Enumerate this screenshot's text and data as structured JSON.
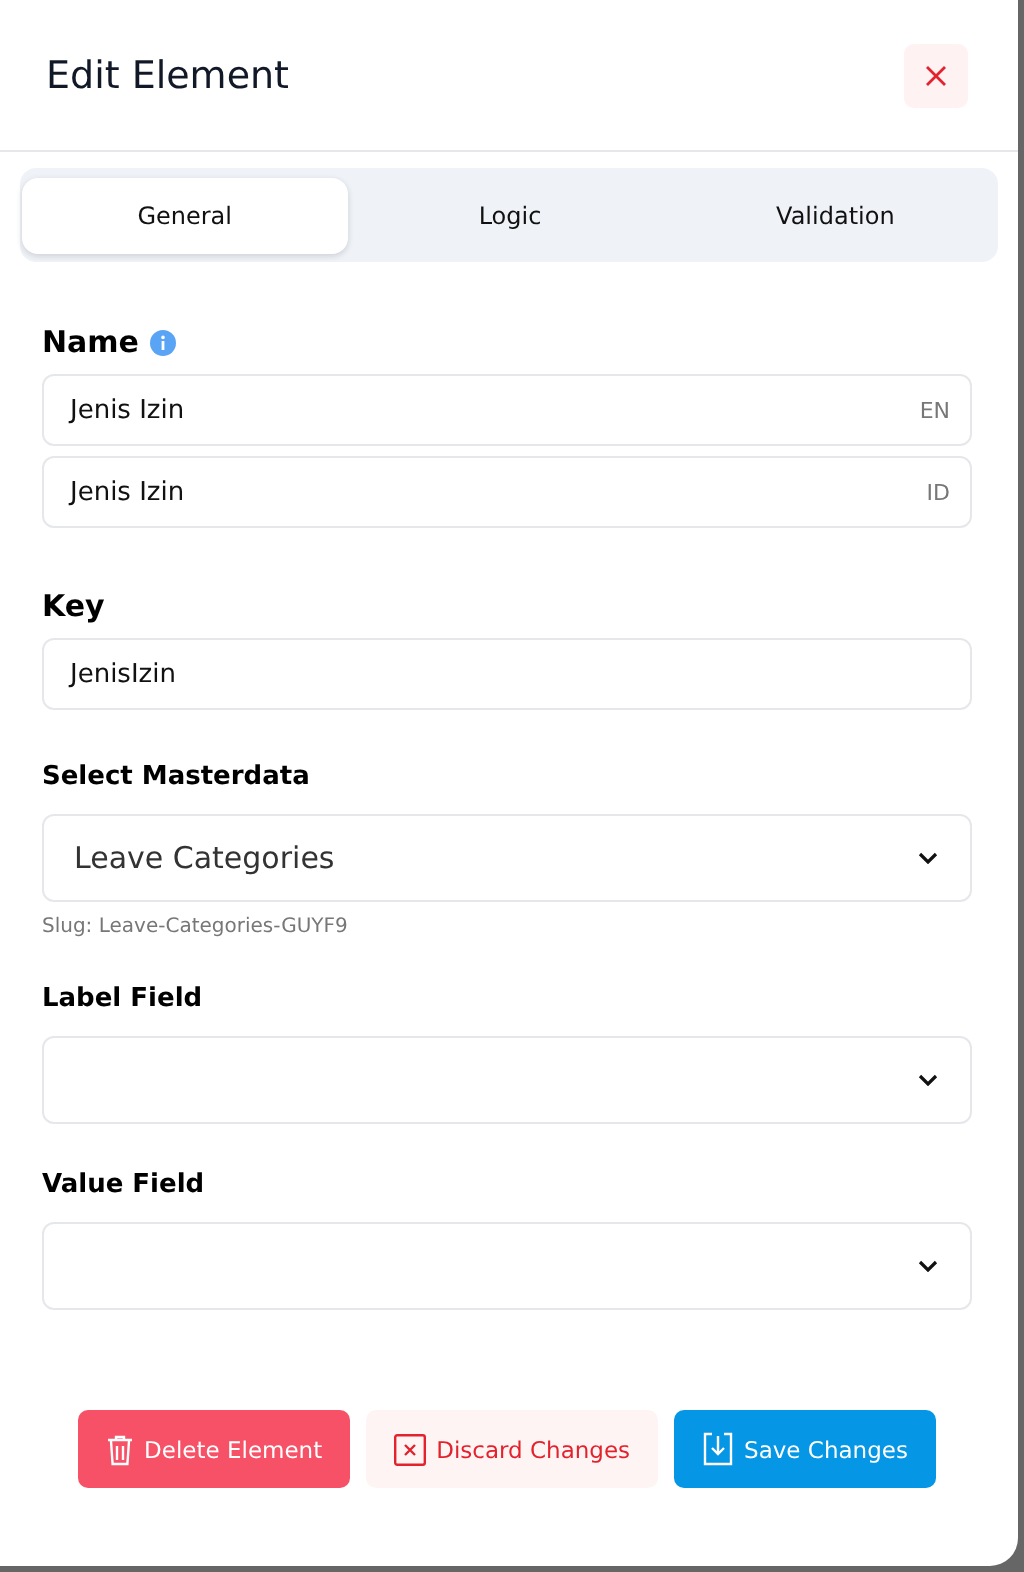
{
  "dialog": {
    "title": "Edit Element"
  },
  "tabs": [
    {
      "label": "General",
      "selected": true
    },
    {
      "label": "Logic",
      "selected": false
    },
    {
      "label": "Validation",
      "selected": false
    }
  ],
  "name": {
    "label": "Name",
    "translations": [
      {
        "value": "Jenis Izin",
        "lang": "EN"
      },
      {
        "value": "Jenis Izin",
        "lang": "ID"
      }
    ]
  },
  "key": {
    "label": "Key",
    "value": "JenisIzin"
  },
  "masterdata": {
    "label": "Select Masterdata",
    "value": "Leave Categories",
    "slug": "Slug: Leave-Categories-GUYF9"
  },
  "selects": [
    {
      "label": "Label Field"
    },
    {
      "label": "Value Field"
    }
  ],
  "buttons": [
    {
      "kind": "delete",
      "label": "Delete Element"
    },
    {
      "kind": "discard",
      "label": "Discard Changes"
    },
    {
      "kind": "save",
      "label": "Save Changes"
    }
  ]
}
